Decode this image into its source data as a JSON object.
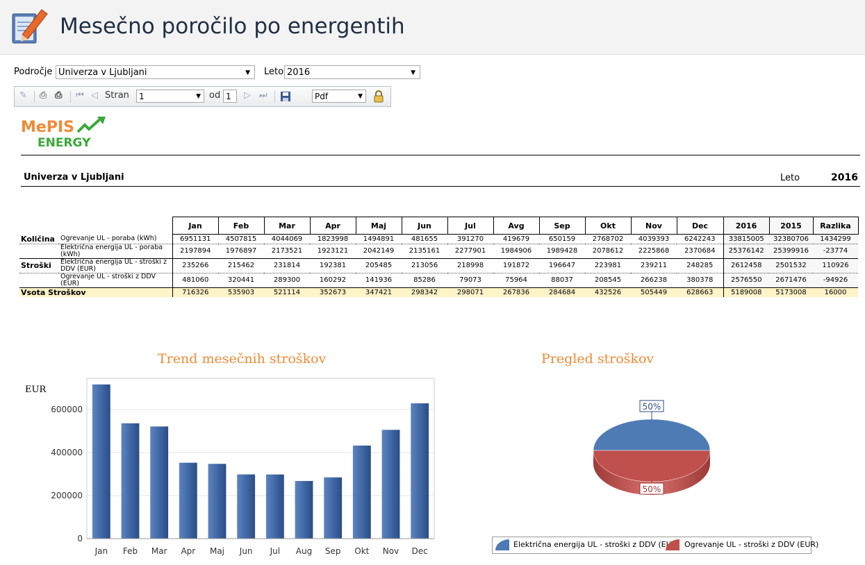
{
  "header": {
    "title": "Mesečno poročilo po energentih",
    "icon": "edit-report-icon"
  },
  "filters": {
    "area_label": "Področje",
    "area_value": "Univerza v Ljubljani",
    "year_label": "Leto",
    "year_value": "2016"
  },
  "toolbar": {
    "page_label": "Stran",
    "page_value": "1",
    "of_label": "od",
    "total_pages": "1",
    "format_value": "Pdf"
  },
  "logo": {
    "text_1": "MePIS",
    "text_2": "ENERGY"
  },
  "report": {
    "org": "Univerza v Ljubljani",
    "year_label": "Leto",
    "year": "2016",
    "columns": [
      "Jan",
      "Feb",
      "Mar",
      "Apr",
      "Maj",
      "Jun",
      "Jul",
      "Avg",
      "Sep",
      "Okt",
      "Nov",
      "Dec",
      "2016",
      "2015",
      "Razlika"
    ],
    "rows": [
      {
        "group": "Količina",
        "label": "Ogrevanje UL - poraba (kWh)",
        "values": [
          "6951131",
          "4507815",
          "4044069",
          "1823998",
          "1494891",
          "481655",
          "391270",
          "419679",
          "650159",
          "2768702",
          "4039393",
          "6242243",
          "33815005",
          "32380706",
          "1434299"
        ]
      },
      {
        "group": "",
        "label": "Električna energija UL - poraba (kWh)",
        "values": [
          "2197894",
          "1976897",
          "2173521",
          "1923121",
          "2042149",
          "2135161",
          "2277901",
          "1984906",
          "1989428",
          "2078612",
          "2225868",
          "2370684",
          "25376142",
          "25399916",
          "-23774"
        ]
      },
      {
        "group": "Stroški",
        "label": "Električna energija UL - stroški z DDV (EUR)",
        "values": [
          "235266",
          "215462",
          "231814",
          "192381",
          "205485",
          "213056",
          "218998",
          "191872",
          "196647",
          "223981",
          "239211",
          "248285",
          "2612458",
          "2501532",
          "110926"
        ]
      },
      {
        "group": "",
        "label": "Ogrevanje UL - stroški z DDV (EUR)",
        "values": [
          "481060",
          "320441",
          "289300",
          "160292",
          "141936",
          "85286",
          "79073",
          "75964",
          "88037",
          "208545",
          "266238",
          "380378",
          "2576550",
          "2671476",
          "-94926"
        ]
      }
    ],
    "total": {
      "label": "Vsota Stroškov",
      "values": [
        "716326",
        "535903",
        "521114",
        "352673",
        "347421",
        "298342",
        "298071",
        "267836",
        "284684",
        "432526",
        "505449",
        "628663",
        "5189008",
        "5173008",
        "16000"
      ]
    }
  },
  "chart_data": [
    {
      "type": "bar",
      "title": "Trend mesečnih stroškov",
      "ylabel": "EUR",
      "categories": [
        "Jan",
        "Feb",
        "Mar",
        "Apr",
        "Maj",
        "Jun",
        "Jul",
        "Aug",
        "Sep",
        "Okt",
        "Nov",
        "Dec"
      ],
      "values": [
        716326,
        535903,
        521114,
        352673,
        347421,
        298342,
        298071,
        267836,
        284684,
        432526,
        505449,
        628663
      ],
      "yticks": [
        0,
        200000,
        400000,
        600000
      ],
      "ylim": [
        0,
        745000
      ],
      "grid": true,
      "color": "#4a6fa5"
    },
    {
      "type": "pie",
      "title": "Pregled stroškov",
      "labels": [
        "Električna energija UL - stroški z DDV (EUR)",
        "Ogrevanje UL - stroški z DDV (EUR)"
      ],
      "values": [
        50,
        50
      ],
      "value_labels": [
        "50%",
        "50%"
      ],
      "colors": [
        "#4f7bb5",
        "#c0504d"
      ],
      "legend": "bottom"
    }
  ]
}
